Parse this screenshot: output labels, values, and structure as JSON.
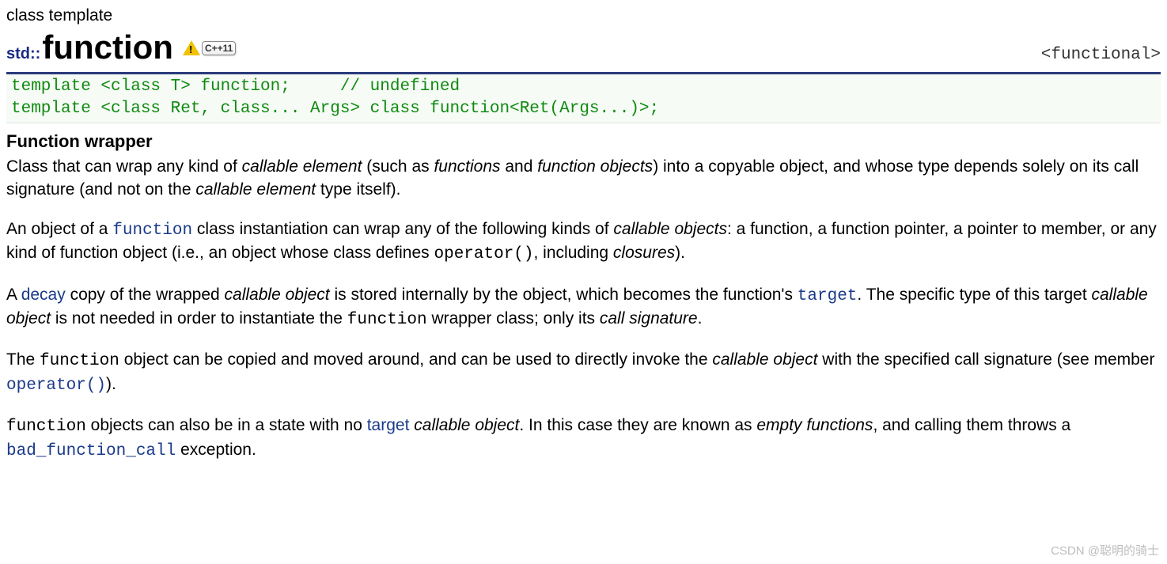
{
  "header": {
    "kind": "class template",
    "namespace": "std::",
    "title": "function",
    "badge_label": "C++11",
    "header_file": "<functional>"
  },
  "declaration": {
    "line1_code": "template <class T> function;",
    "line1_comment": "// undefined",
    "line2": "template <class Ret, class... Args> class function<Ret(Args...)>;"
  },
  "section_title": "Function wrapper",
  "p1": {
    "a": "Class that can wrap any kind of ",
    "callable_element": "callable element",
    "b": " (such as ",
    "functions": "functions",
    "c": " and ",
    "function_objects": "function objects",
    "d": ") into a copyable object, and whose type depends solely on its call signature (and not on the ",
    "callable_element2": "callable element",
    "e": " type itself)."
  },
  "p2": {
    "a": "An object of a ",
    "function_link": "function",
    "b": " class instantiation can wrap any of the following kinds of ",
    "callable_objects": "callable objects",
    "c": ": a function, a function pointer, a pointer to member, or any kind of function object (i.e., an object whose class defines ",
    "operator_call": "operator()",
    "d": ", including ",
    "closures": "closures",
    "e": ")."
  },
  "p3": {
    "a": "A ",
    "decay_link": "decay",
    "b": " copy of the wrapped ",
    "callable_object": "callable object",
    "c": " is stored internally by the object, which becomes the function's ",
    "target_link": "target",
    "d": ". The specific type of this target ",
    "callable_object2": "callable object",
    "e": " is not needed in order to instantiate the ",
    "function_mono": "function",
    "f": " wrapper class; only its ",
    "call_signature": "call signature",
    "g": "."
  },
  "p4": {
    "a": "The ",
    "function_mono": "function",
    "b": " object can be copied and moved around, and can be used to directly invoke the ",
    "callable_object": "callable object",
    "c": " with the specified call signature (see member ",
    "operator_link": "operator()",
    "d": ")."
  },
  "p5": {
    "function_mono": "function",
    "a": " objects can also be in a state with no ",
    "target_link": "target",
    "space": " ",
    "callable_object": "callable object",
    "b": ". In this case they are known as ",
    "empty_functions": "empty functions",
    "c": ", and calling them throws a ",
    "bad_function_call_link": "bad_function_call",
    "d": " exception."
  },
  "watermark": "CSDN @聪明的骑士"
}
